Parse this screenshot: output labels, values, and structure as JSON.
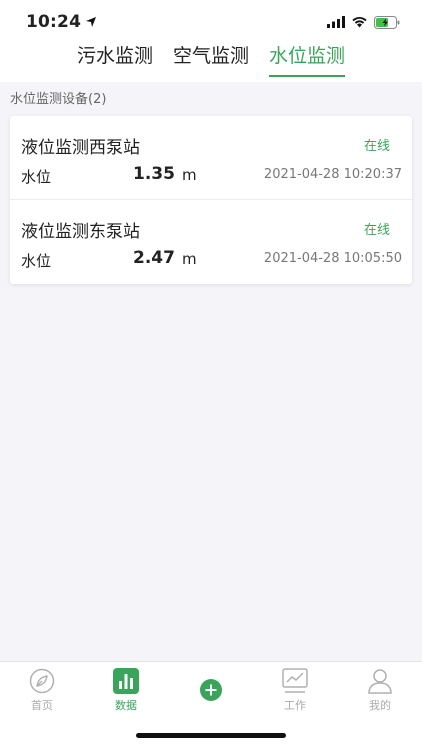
{
  "status_bar": {
    "time": "10:24"
  },
  "tabs": [
    {
      "label": "污水监测",
      "active": false
    },
    {
      "label": "空气监测",
      "active": false
    },
    {
      "label": "水位监测",
      "active": true
    }
  ],
  "section": {
    "title": "水位监测设备(2)"
  },
  "devices": [
    {
      "name": "液位监测西泵站",
      "status": "在线",
      "metric_label": "水位",
      "value": "1.35",
      "unit": "m",
      "timestamp": "2021-04-28 10:20:37"
    },
    {
      "name": "液位监测东泵站",
      "status": "在线",
      "metric_label": "水位",
      "value": "2.47",
      "unit": "m",
      "timestamp": "2021-04-28 10:05:50"
    }
  ],
  "bottom_nav": [
    {
      "label": "首页",
      "icon": "compass-icon"
    },
    {
      "label": "数据",
      "icon": "bar-chart-icon",
      "active": true
    },
    {
      "label": "",
      "icon": "plus-circle-icon"
    },
    {
      "label": "工作",
      "icon": "line-chart-icon"
    },
    {
      "label": "我的",
      "icon": "user-icon"
    }
  ],
  "colors": {
    "accent": "#3aa55a",
    "status_online": "#3aa55a",
    "inactive": "#aaaaaa"
  }
}
